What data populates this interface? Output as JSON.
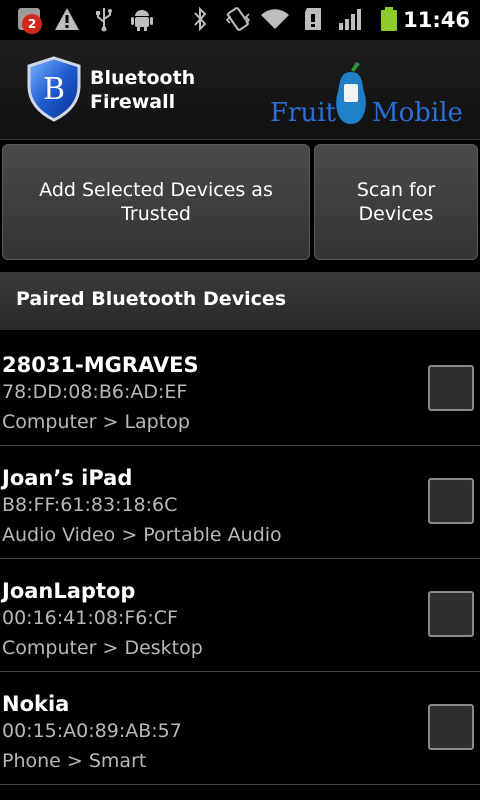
{
  "status_bar": {
    "notification_count": "2",
    "time": "11:46",
    "icons": [
      "notification-icon",
      "warning-icon",
      "usb-icon",
      "android-debug-icon",
      "bluetooth-icon",
      "vibrate-icon",
      "wifi-icon",
      "sd-card-icon",
      "signal-icon",
      "battery-icon"
    ]
  },
  "header": {
    "app_title": "Bluetooth Firewall",
    "shield_letter": "B",
    "brand_left": "Fruit",
    "brand_right": "Mobile"
  },
  "buttons": {
    "add_trusted": "Add Selected Devices as Trusted",
    "scan": "Scan for Devices"
  },
  "section": {
    "title": "Paired Bluetooth Devices"
  },
  "devices": [
    {
      "name": "28031-MGRAVES",
      "mac": "78:DD:08:B6:AD:EF",
      "type": "Computer > Laptop"
    },
    {
      "name": "Joan’s iPad",
      "mac": "B8:FF:61:83:18:6C",
      "type": "Audio Video > Portable Audio"
    },
    {
      "name": "JoanLaptop",
      "mac": "00:16:41:08:F6:CF",
      "type": "Computer > Desktop"
    },
    {
      "name": "Nokia",
      "mac": "00:15:A0:89:AB:57",
      "type": "Phone > Smart"
    }
  ],
  "colors": {
    "brand_blue": "#2a6fd6",
    "background": "#000000",
    "battery_green": "#8ecb2c",
    "notification_red": "#d3261d"
  }
}
